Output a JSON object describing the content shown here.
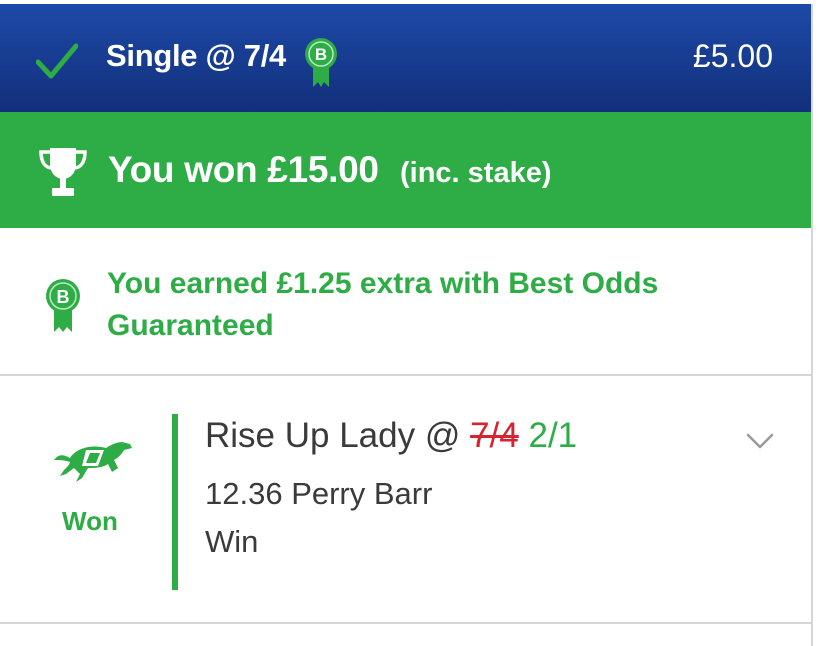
{
  "header": {
    "title": "Single @ 7/4",
    "stake": "£5.00",
    "badge_letter": "B"
  },
  "result_banner": {
    "won_text": "You won £15.00",
    "inc_text": "(inc. stake)"
  },
  "best_odds": {
    "badge_letter": "B",
    "message": "You earned £1.25 extra with Best Odds Guaranteed"
  },
  "selection": {
    "result": "Won",
    "name": "Rise Up Lady @",
    "original_odds": "7/4",
    "final_odds": "2/1",
    "event": "12.36 Perry Barr",
    "market": "Win"
  },
  "colors": {
    "header_blue": "#1d4aa8",
    "win_green": "#2eac45",
    "strike_red": "#d5232f"
  },
  "icons": [
    "check-icon",
    "badge-icon",
    "trophy-icon",
    "greyhound-icon",
    "chevron-down-icon"
  ]
}
